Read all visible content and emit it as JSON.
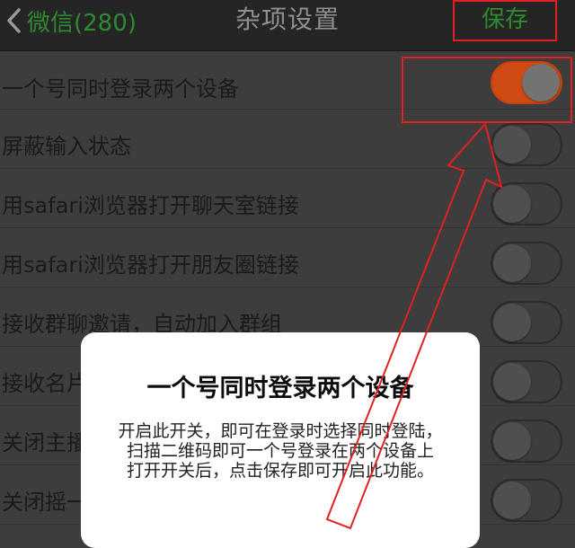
{
  "navbar": {
    "back_label": "微信(280)",
    "title": "杂项设置",
    "save_label": "保存"
  },
  "settings": [
    {
      "label": "一个号同时登录两个设备",
      "on": true
    },
    {
      "label": "屏蔽输入状态",
      "on": false
    },
    {
      "label": "用safari浏览器打开聊天室链接",
      "on": false
    },
    {
      "label": "用safari浏览器打开朋友圈链接",
      "on": false
    },
    {
      "label": "接收群聊邀请，自动加入群组",
      "on": false
    },
    {
      "label": "接收名片",
      "on": false
    },
    {
      "label": "关闭主播",
      "on": false
    },
    {
      "label": "关闭摇一摇",
      "on": false
    }
  ],
  "popup": {
    "title": "一个号同时登录两个设备",
    "line1": "开启此开关，即可在登录时选择同时登陆，扫描二维码即可一个号登录在两个设备上",
    "line2": "打开开关后，点击保存即可开启此功能。"
  },
  "colors": {
    "accent_green": "#2f8a2f",
    "toggle_on": "#d04a14",
    "annotation_red": "#e22020"
  }
}
